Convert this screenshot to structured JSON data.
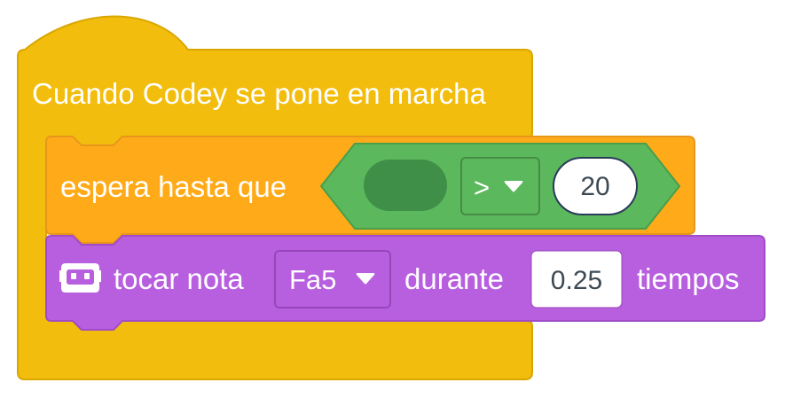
{
  "hat_block": {
    "label": "Cuando Codey se pone en marcha",
    "color": "#F2BD0C"
  },
  "wait_block": {
    "label": "espera hasta que",
    "color": "#FFAB19",
    "condition": {
      "color": "#5CB85C",
      "operator": ">",
      "operator_icon": "caret-down-icon",
      "right_value": "20"
    }
  },
  "play_note_block": {
    "icon": "codey-robot-icon",
    "label_prefix": "tocar nota",
    "note": "Fa5",
    "note_icon": "caret-down-icon",
    "label_middle": "durante",
    "beats": "0.25",
    "label_suffix": "tiempos",
    "color": "#B85FE0"
  }
}
